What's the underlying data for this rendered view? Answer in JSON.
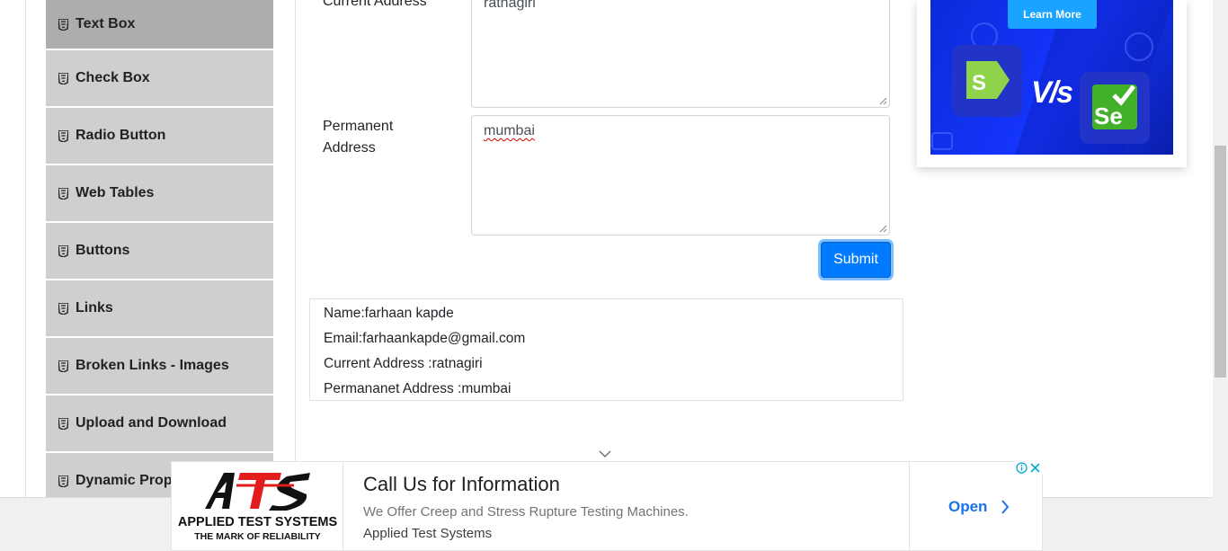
{
  "sidebar": {
    "items": [
      {
        "label": "Text Box",
        "active": true
      },
      {
        "label": "Check Box"
      },
      {
        "label": "Radio Button"
      },
      {
        "label": "Web Tables"
      },
      {
        "label": "Buttons"
      },
      {
        "label": "Links"
      },
      {
        "label": "Broken Links - Images"
      },
      {
        "label": "Upload and Download"
      },
      {
        "label": "Dynamic Prop"
      }
    ],
    "item_icon": "html5-icon"
  },
  "form": {
    "current_address_label": "Current Address",
    "current_address_value": "ratnagiri",
    "permanent_address_label_line1": "Permanent",
    "permanent_address_label_line2": "Address",
    "permanent_address_value": "mumbai",
    "submit_label": "Submit"
  },
  "output": {
    "name": "Name:farhaan kapde",
    "email": "Email:farhaankapde@gmail.com",
    "current_address": "Current Address :ratnagiri",
    "permanent_address": "Permananet Address :mumbai"
  },
  "side_ad": {
    "button_label": "Learn More",
    "vs_text": "V/s",
    "right_logo_text": "Se"
  },
  "bottom_ad": {
    "logo_name": "APPLIED TEST SYSTEMS",
    "logo_tagline": "THE MARK OF RELIABILITY",
    "title": "Call Us for Information",
    "description": "We Offer Creep and Stress Rupture Testing Machines.",
    "advertiser": "Applied Test Systems",
    "cta": "Open"
  },
  "colors": {
    "primary": "#007bff",
    "sidebar_bg": "#cfcfcf",
    "sidebar_active": "#adadad",
    "ad_blue": "#1536ff",
    "ad_link": "#1a73e8"
  }
}
